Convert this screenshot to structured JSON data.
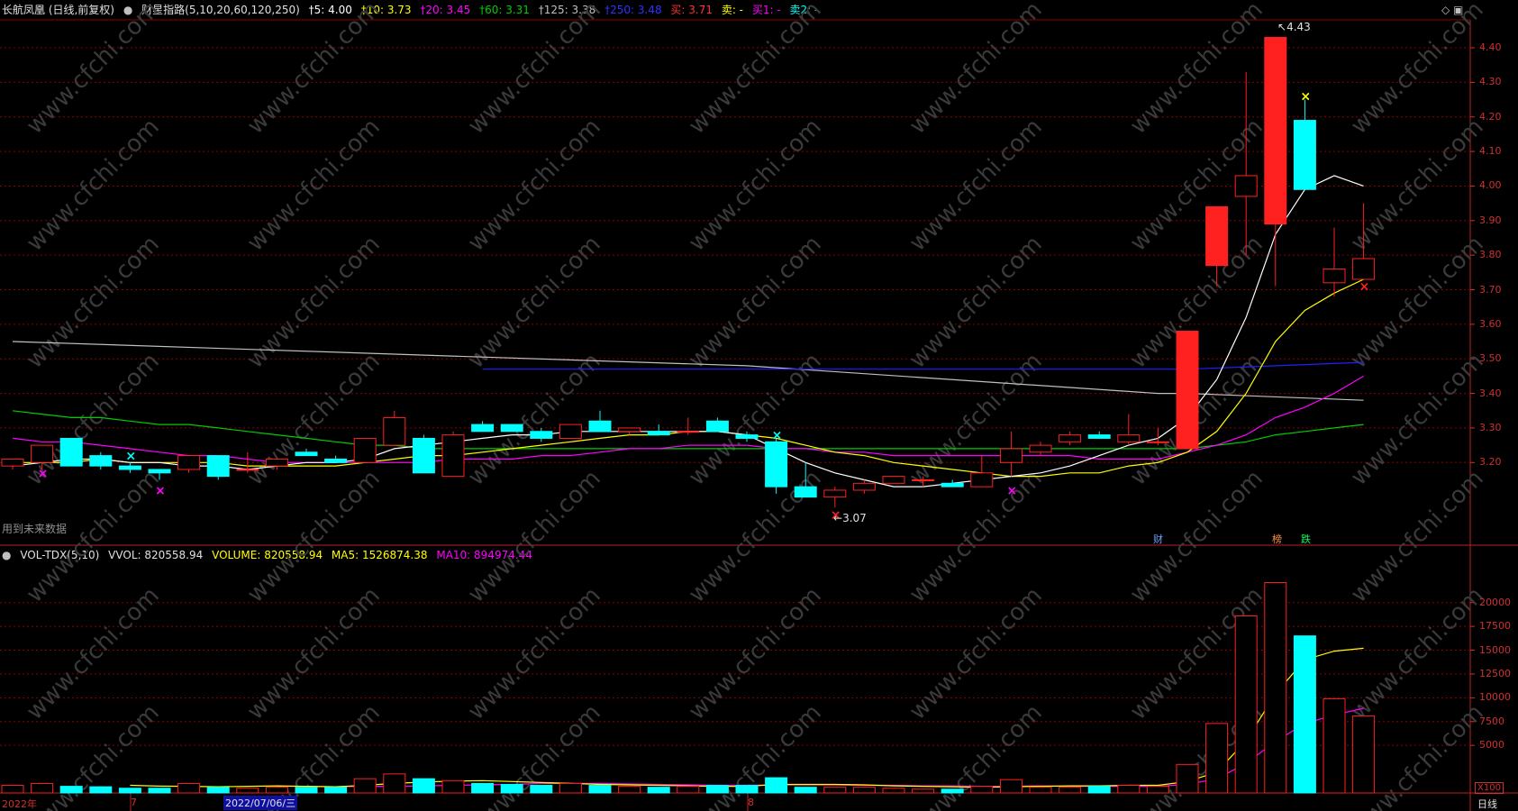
{
  "header": {
    "stock_name": "长航凤凰 (日线,前复权)",
    "indicator_name": "财星指路(5,10,20,60,120,250)",
    "ma5": "†5: 4.00",
    "ma10": "†10: 3.73",
    "ma20": "†20: 3.45",
    "ma60": "†60: 3.31",
    "ma125": "†125: 3.38",
    "ma250": "†250: 3.48",
    "buy": "买: 3.71",
    "sell": "卖: -",
    "buy1": "买1: -",
    "sell2": "卖2: -",
    "right_icons": "◇ ▣"
  },
  "volume_header": {
    "title": "VOL-TDX(5,10)",
    "vvol": "VVOL: 820558.94",
    "volume": "VOLUME: 820558.94",
    "ma5": "MA5: 1526874.38",
    "ma10": "MA10: 894974.44"
  },
  "colors": {
    "up": "#ff2020",
    "down": "#00ffff",
    "ma5": "#ffffff",
    "ma10": "#ffff00",
    "ma20": "#ff00ff",
    "ma60": "#00cc00",
    "ma125": "#c0c0c0",
    "ma250": "#2020ff",
    "grid": "#8b0000",
    "axis": "#d03030"
  },
  "watermark": "www.cfchi.com",
  "note_future": "用到未来数据",
  "annotations": {
    "high_label": "4.43",
    "low_label": "3.07",
    "event_cai": "财",
    "event_bang": "榜",
    "event_die": "跌"
  },
  "x_axis": {
    "year_label": "2022年",
    "month7": "7",
    "date_label": "2022/07/06/三",
    "month8": "8",
    "period": "日线",
    "vol_unit": "X100"
  },
  "chart_data": {
    "type": "candlestick",
    "price_ylim": [
      3.0,
      4.46
    ],
    "price_ticks": [
      "4.40",
      "4.30",
      "4.20",
      "4.10",
      "4.00",
      "3.90",
      "3.80",
      "3.70",
      "3.60",
      "3.50",
      "3.40",
      "3.30",
      "3.20"
    ],
    "vol_ylim": [
      0,
      23000
    ],
    "vol_ticks": [
      "20000",
      "17500",
      "15000",
      "12500",
      "10000",
      "7500",
      "5000"
    ],
    "candles": [
      {
        "o": 3.19,
        "h": 3.21,
        "l": 3.18,
        "c": 3.21,
        "v": 800
      },
      {
        "o": 3.2,
        "h": 3.25,
        "l": 3.18,
        "c": 3.25,
        "v": 1000
      },
      {
        "o": 3.27,
        "h": 3.27,
        "l": 3.19,
        "c": 3.19,
        "v": 700
      },
      {
        "o": 3.22,
        "h": 3.23,
        "l": 3.18,
        "c": 3.19,
        "v": 650
      },
      {
        "o": 3.19,
        "h": 3.2,
        "l": 3.17,
        "c": 3.18,
        "v": 500
      },
      {
        "o": 3.18,
        "h": 3.18,
        "l": 3.15,
        "c": 3.17,
        "v": 500
      },
      {
        "o": 3.18,
        "h": 3.22,
        "l": 3.17,
        "c": 3.22,
        "v": 1000
      },
      {
        "o": 3.22,
        "h": 3.22,
        "l": 3.15,
        "c": 3.16,
        "v": 600
      },
      {
        "o": 3.18,
        "h": 3.23,
        "l": 3.17,
        "c": 3.18,
        "v": 500
      },
      {
        "o": 3.19,
        "h": 3.21,
        "l": 3.18,
        "c": 3.21,
        "v": 600
      },
      {
        "o": 3.23,
        "h": 3.24,
        "l": 3.22,
        "c": 3.22,
        "v": 600
      },
      {
        "o": 3.21,
        "h": 3.22,
        "l": 3.2,
        "c": 3.2,
        "v": 600
      },
      {
        "o": 3.2,
        "h": 3.27,
        "l": 3.2,
        "c": 3.27,
        "v": 1500
      },
      {
        "o": 3.25,
        "h": 3.35,
        "l": 3.25,
        "c": 3.33,
        "v": 2000
      },
      {
        "o": 3.27,
        "h": 3.28,
        "l": 3.17,
        "c": 3.17,
        "v": 1500
      },
      {
        "o": 3.16,
        "h": 3.29,
        "l": 3.16,
        "c": 3.28,
        "v": 1300
      },
      {
        "o": 3.31,
        "h": 3.32,
        "l": 3.29,
        "c": 3.29,
        "v": 1000
      },
      {
        "o": 3.31,
        "h": 3.31,
        "l": 3.29,
        "c": 3.29,
        "v": 900
      },
      {
        "o": 3.29,
        "h": 3.3,
        "l": 3.26,
        "c": 3.27,
        "v": 800
      },
      {
        "o": 3.27,
        "h": 3.31,
        "l": 3.27,
        "c": 3.31,
        "v": 1000
      },
      {
        "o": 3.32,
        "h": 3.35,
        "l": 3.29,
        "c": 3.29,
        "v": 800
      },
      {
        "o": 3.29,
        "h": 3.3,
        "l": 3.28,
        "c": 3.3,
        "v": 700
      },
      {
        "o": 3.29,
        "h": 3.31,
        "l": 3.28,
        "c": 3.28,
        "v": 600
      },
      {
        "o": 3.29,
        "h": 3.33,
        "l": 3.28,
        "c": 3.29,
        "v": 700
      },
      {
        "o": 3.32,
        "h": 3.33,
        "l": 3.29,
        "c": 3.29,
        "v": 800
      },
      {
        "o": 3.28,
        "h": 3.29,
        "l": 3.26,
        "c": 3.27,
        "v": 800
      },
      {
        "o": 3.26,
        "h": 3.27,
        "l": 3.11,
        "c": 3.13,
        "v": 1600
      },
      {
        "o": 3.13,
        "h": 3.2,
        "l": 3.1,
        "c": 3.1,
        "v": 600
      },
      {
        "o": 3.1,
        "h": 3.13,
        "l": 3.07,
        "c": 3.12,
        "v": 600
      },
      {
        "o": 3.12,
        "h": 3.15,
        "l": 3.11,
        "c": 3.14,
        "v": 600
      },
      {
        "o": 3.14,
        "h": 3.16,
        "l": 3.14,
        "c": 3.16,
        "v": 500
      },
      {
        "o": 3.15,
        "h": 3.16,
        "l": 3.13,
        "c": 3.15,
        "v": 400
      },
      {
        "o": 3.14,
        "h": 3.15,
        "l": 3.13,
        "c": 3.13,
        "v": 400
      },
      {
        "o": 3.13,
        "h": 3.22,
        "l": 3.13,
        "c": 3.17,
        "v": 700
      },
      {
        "o": 3.2,
        "h": 3.29,
        "l": 3.16,
        "c": 3.24,
        "v": 1400
      },
      {
        "o": 3.23,
        "h": 3.26,
        "l": 3.22,
        "c": 3.25,
        "v": 600
      },
      {
        "o": 3.26,
        "h": 3.29,
        "l": 3.25,
        "c": 3.28,
        "v": 600
      },
      {
        "o": 3.28,
        "h": 3.29,
        "l": 3.27,
        "c": 3.27,
        "v": 700
      },
      {
        "o": 3.26,
        "h": 3.34,
        "l": 3.25,
        "c": 3.28,
        "v": 800
      },
      {
        "o": 3.26,
        "h": 3.3,
        "l": 3.25,
        "c": 3.26,
        "v": 700
      },
      {
        "o": 3.24,
        "h": 3.58,
        "l": 3.24,
        "c": 3.58,
        "v": 3000
      },
      {
        "o": 3.77,
        "h": 3.94,
        "l": 3.71,
        "c": 3.94,
        "v": 7300
      },
      {
        "o": 3.97,
        "h": 4.33,
        "l": 3.8,
        "c": 4.03,
        "v": 18600
      },
      {
        "o": 3.89,
        "h": 4.43,
        "l": 3.71,
        "c": 4.43,
        "v": 22100
      },
      {
        "o": 4.19,
        "h": 4.25,
        "l": 3.99,
        "c": 3.99,
        "v": 16500
      },
      {
        "o": 3.72,
        "h": 3.88,
        "l": 3.68,
        "c": 3.76,
        "v": 9900
      },
      {
        "o": 3.73,
        "h": 3.95,
        "l": 3.73,
        "c": 3.79,
        "v": 8100
      }
    ],
    "ma": {
      "ma5": [
        3.19,
        3.2,
        3.21,
        3.21,
        3.2,
        3.2,
        3.19,
        3.19,
        3.18,
        3.19,
        3.2,
        3.2,
        3.21,
        3.24,
        3.25,
        3.26,
        3.27,
        3.28,
        3.28,
        3.29,
        3.29,
        3.29,
        3.29,
        3.29,
        3.29,
        3.28,
        3.24,
        3.2,
        3.17,
        3.15,
        3.13,
        3.13,
        3.14,
        3.15,
        3.16,
        3.17,
        3.19,
        3.22,
        3.25,
        3.27,
        3.33,
        3.44,
        3.62,
        3.86,
        3.99,
        4.03,
        4.0
      ],
      "ma10": [
        3.2,
        3.2,
        3.2,
        3.21,
        3.2,
        3.2,
        3.2,
        3.2,
        3.19,
        3.19,
        3.19,
        3.19,
        3.2,
        3.21,
        3.22,
        3.22,
        3.23,
        3.24,
        3.25,
        3.26,
        3.27,
        3.28,
        3.28,
        3.29,
        3.29,
        3.28,
        3.27,
        3.25,
        3.23,
        3.22,
        3.2,
        3.19,
        3.18,
        3.17,
        3.16,
        3.16,
        3.17,
        3.17,
        3.19,
        3.2,
        3.23,
        3.29,
        3.4,
        3.55,
        3.64,
        3.69,
        3.73
      ],
      "ma20": [
        3.27,
        3.26,
        3.26,
        3.25,
        3.24,
        3.23,
        3.22,
        3.22,
        3.21,
        3.2,
        3.2,
        3.2,
        3.2,
        3.2,
        3.2,
        3.21,
        3.21,
        3.21,
        3.22,
        3.22,
        3.23,
        3.24,
        3.24,
        3.25,
        3.25,
        3.25,
        3.24,
        3.24,
        3.23,
        3.23,
        3.22,
        3.22,
        3.22,
        3.22,
        3.22,
        3.22,
        3.22,
        3.21,
        3.21,
        3.21,
        3.23,
        3.25,
        3.28,
        3.33,
        3.36,
        3.4,
        3.45
      ],
      "ma60": [
        3.35,
        3.34,
        3.33,
        3.33,
        3.32,
        3.31,
        3.31,
        3.3,
        3.29,
        3.28,
        3.27,
        3.26,
        3.25,
        3.25,
        3.24,
        3.24,
        3.24,
        3.24,
        3.24,
        3.24,
        3.24,
        3.24,
        3.24,
        3.24,
        3.24,
        3.24,
        3.24,
        3.24,
        3.24,
        3.24,
        3.24,
        3.24,
        3.24,
        3.24,
        3.24,
        3.24,
        3.24,
        3.24,
        3.24,
        3.24,
        3.24,
        3.25,
        3.26,
        3.28,
        3.29,
        3.3,
        3.31
      ],
      "ma125": [
        3.55,
        null,
        null,
        null,
        null,
        null,
        null,
        null,
        null,
        null,
        null,
        null,
        null,
        null,
        null,
        null,
        null,
        null,
        null,
        null,
        null,
        null,
        null,
        null,
        null,
        3.48,
        null,
        null,
        null,
        null,
        null,
        null,
        null,
        null,
        null,
        null,
        null,
        null,
        null,
        3.4,
        3.4,
        null,
        null,
        null,
        null,
        null,
        3.38
      ],
      "ma250": [
        null,
        null,
        null,
        null,
        null,
        null,
        null,
        null,
        null,
        null,
        null,
        null,
        null,
        null,
        null,
        null,
        3.47,
        null,
        null,
        null,
        null,
        null,
        null,
        null,
        null,
        null,
        null,
        null,
        null,
        null,
        null,
        null,
        null,
        null,
        null,
        null,
        null,
        null,
        null,
        null,
        3.47,
        null,
        null,
        null,
        null,
        null,
        3.49
      ],
      "vol_ma5": [
        null,
        null,
        null,
        null,
        800,
        720,
        700,
        650,
        700,
        750,
        700,
        650,
        800,
        1000,
        1150,
        1250,
        1300,
        1200,
        1100,
        1000,
        900,
        850,
        800,
        750,
        700,
        700,
        900,
        900,
        900,
        850,
        750,
        700,
        650,
        600,
        650,
        700,
        750,
        750,
        800,
        800,
        1200,
        2200,
        5500,
        10400,
        14000,
        14900,
        15200
      ],
      "vol_ma10": [
        null,
        null,
        null,
        null,
        null,
        null,
        null,
        null,
        null,
        700,
        700,
        650,
        700,
        700,
        750,
        800,
        850,
        900,
        1000,
        1000,
        1000,
        950,
        900,
        850,
        800,
        800,
        850,
        850,
        850,
        800,
        800,
        750,
        750,
        700,
        700,
        750,
        700,
        700,
        700,
        700,
        900,
        1500,
        3100,
        5400,
        7300,
        8200,
        8900
      ]
    },
    "signals": [
      {
        "i": 1,
        "price": 3.17,
        "color": "#ff00ff"
      },
      {
        "i": 4,
        "price": 3.22,
        "color": "#00ffff"
      },
      {
        "i": 5,
        "price": 3.12,
        "color": "#ff00ff"
      },
      {
        "i": 26,
        "price": 3.28,
        "color": "#00ffff"
      },
      {
        "i": 28,
        "price": 3.05,
        "color": "#ff2020"
      },
      {
        "i": 34,
        "price": 3.12,
        "color": "#ff00ff"
      },
      {
        "i": 44,
        "price": 4.26,
        "color": "#ffff00"
      },
      {
        "i": 46,
        "price": 3.71,
        "color": "#ff2020"
      }
    ]
  }
}
